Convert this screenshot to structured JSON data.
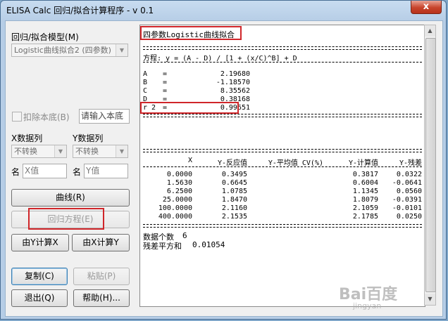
{
  "window": {
    "title": "ELISA Calc 回归/拟合计算程序 - v 0.1",
    "close": "x"
  },
  "left": {
    "model_label": "回归/拟合模型(M)",
    "model_value": "Logistic曲线拟合2 (四参数)",
    "subtract_baseline": "扣除本底(B)",
    "baseline_input": "请输入本底",
    "x_data_label": "X数据列",
    "y_data_label": "Y数据列",
    "x_transform": "不转换",
    "y_transform": "不转换",
    "name_label_x": "名",
    "name_label_y": "名",
    "x_name": "X值",
    "y_name": "Y值",
    "btn_curve": "曲线(R)",
    "btn_regression": "回归方程(E)",
    "btn_calc_x": "由Y计算X",
    "btn_calc_y": "由X计算Y",
    "btn_copy": "复制(C)",
    "btn_paste": "粘贴(P)",
    "btn_exit": "退出(Q)",
    "btn_help": "帮助(H)..."
  },
  "output": {
    "heading": "四参数Logistic曲线拟合",
    "equation": "方程: y = (A - D) / [1 + (x/C)^B] + D",
    "params": [
      {
        "name": "A",
        "eq": "=",
        "value": "2.19680"
      },
      {
        "name": "B",
        "eq": "=",
        "value": "-1.18570"
      },
      {
        "name": "C",
        "eq": "=",
        "value": "8.35562"
      },
      {
        "name": "D",
        "eq": "=",
        "value": "0.38168"
      },
      {
        "name": "r 2",
        "eq": "=",
        "value": "0.99651"
      }
    ],
    "table_headers": [
      "X",
      "Y-反应值",
      "Y-平均值 CV(%)",
      "Y-计算值",
      "Y-残差"
    ],
    "table_rows": [
      {
        "x": "0.0000",
        "y": "0.3495",
        "calc": "0.3817",
        "resid": "0.0322"
      },
      {
        "x": "1.5630",
        "y": "0.6645",
        "calc": "0.6004",
        "resid": "-0.0641"
      },
      {
        "x": "6.2500",
        "y": "1.0785",
        "calc": "1.1345",
        "resid": "0.0560"
      },
      {
        "x": "25.0000",
        "y": "1.8470",
        "calc": "1.8079",
        "resid": "-0.0391"
      },
      {
        "x": "100.0000",
        "y": "2.1160",
        "calc": "2.1059",
        "resid": "-0.0101"
      },
      {
        "x": "400.0000",
        "y": "2.1535",
        "calc": "2.1785",
        "resid": "0.0250"
      }
    ],
    "count_label": "数据个数",
    "count_value": "6",
    "ssr_label": "残差平方和",
    "ssr_value": "0.01054"
  },
  "watermark": {
    "main": "Bai百度",
    "sub": "jingyan"
  },
  "colors": {
    "highlight": "#d0262a"
  }
}
